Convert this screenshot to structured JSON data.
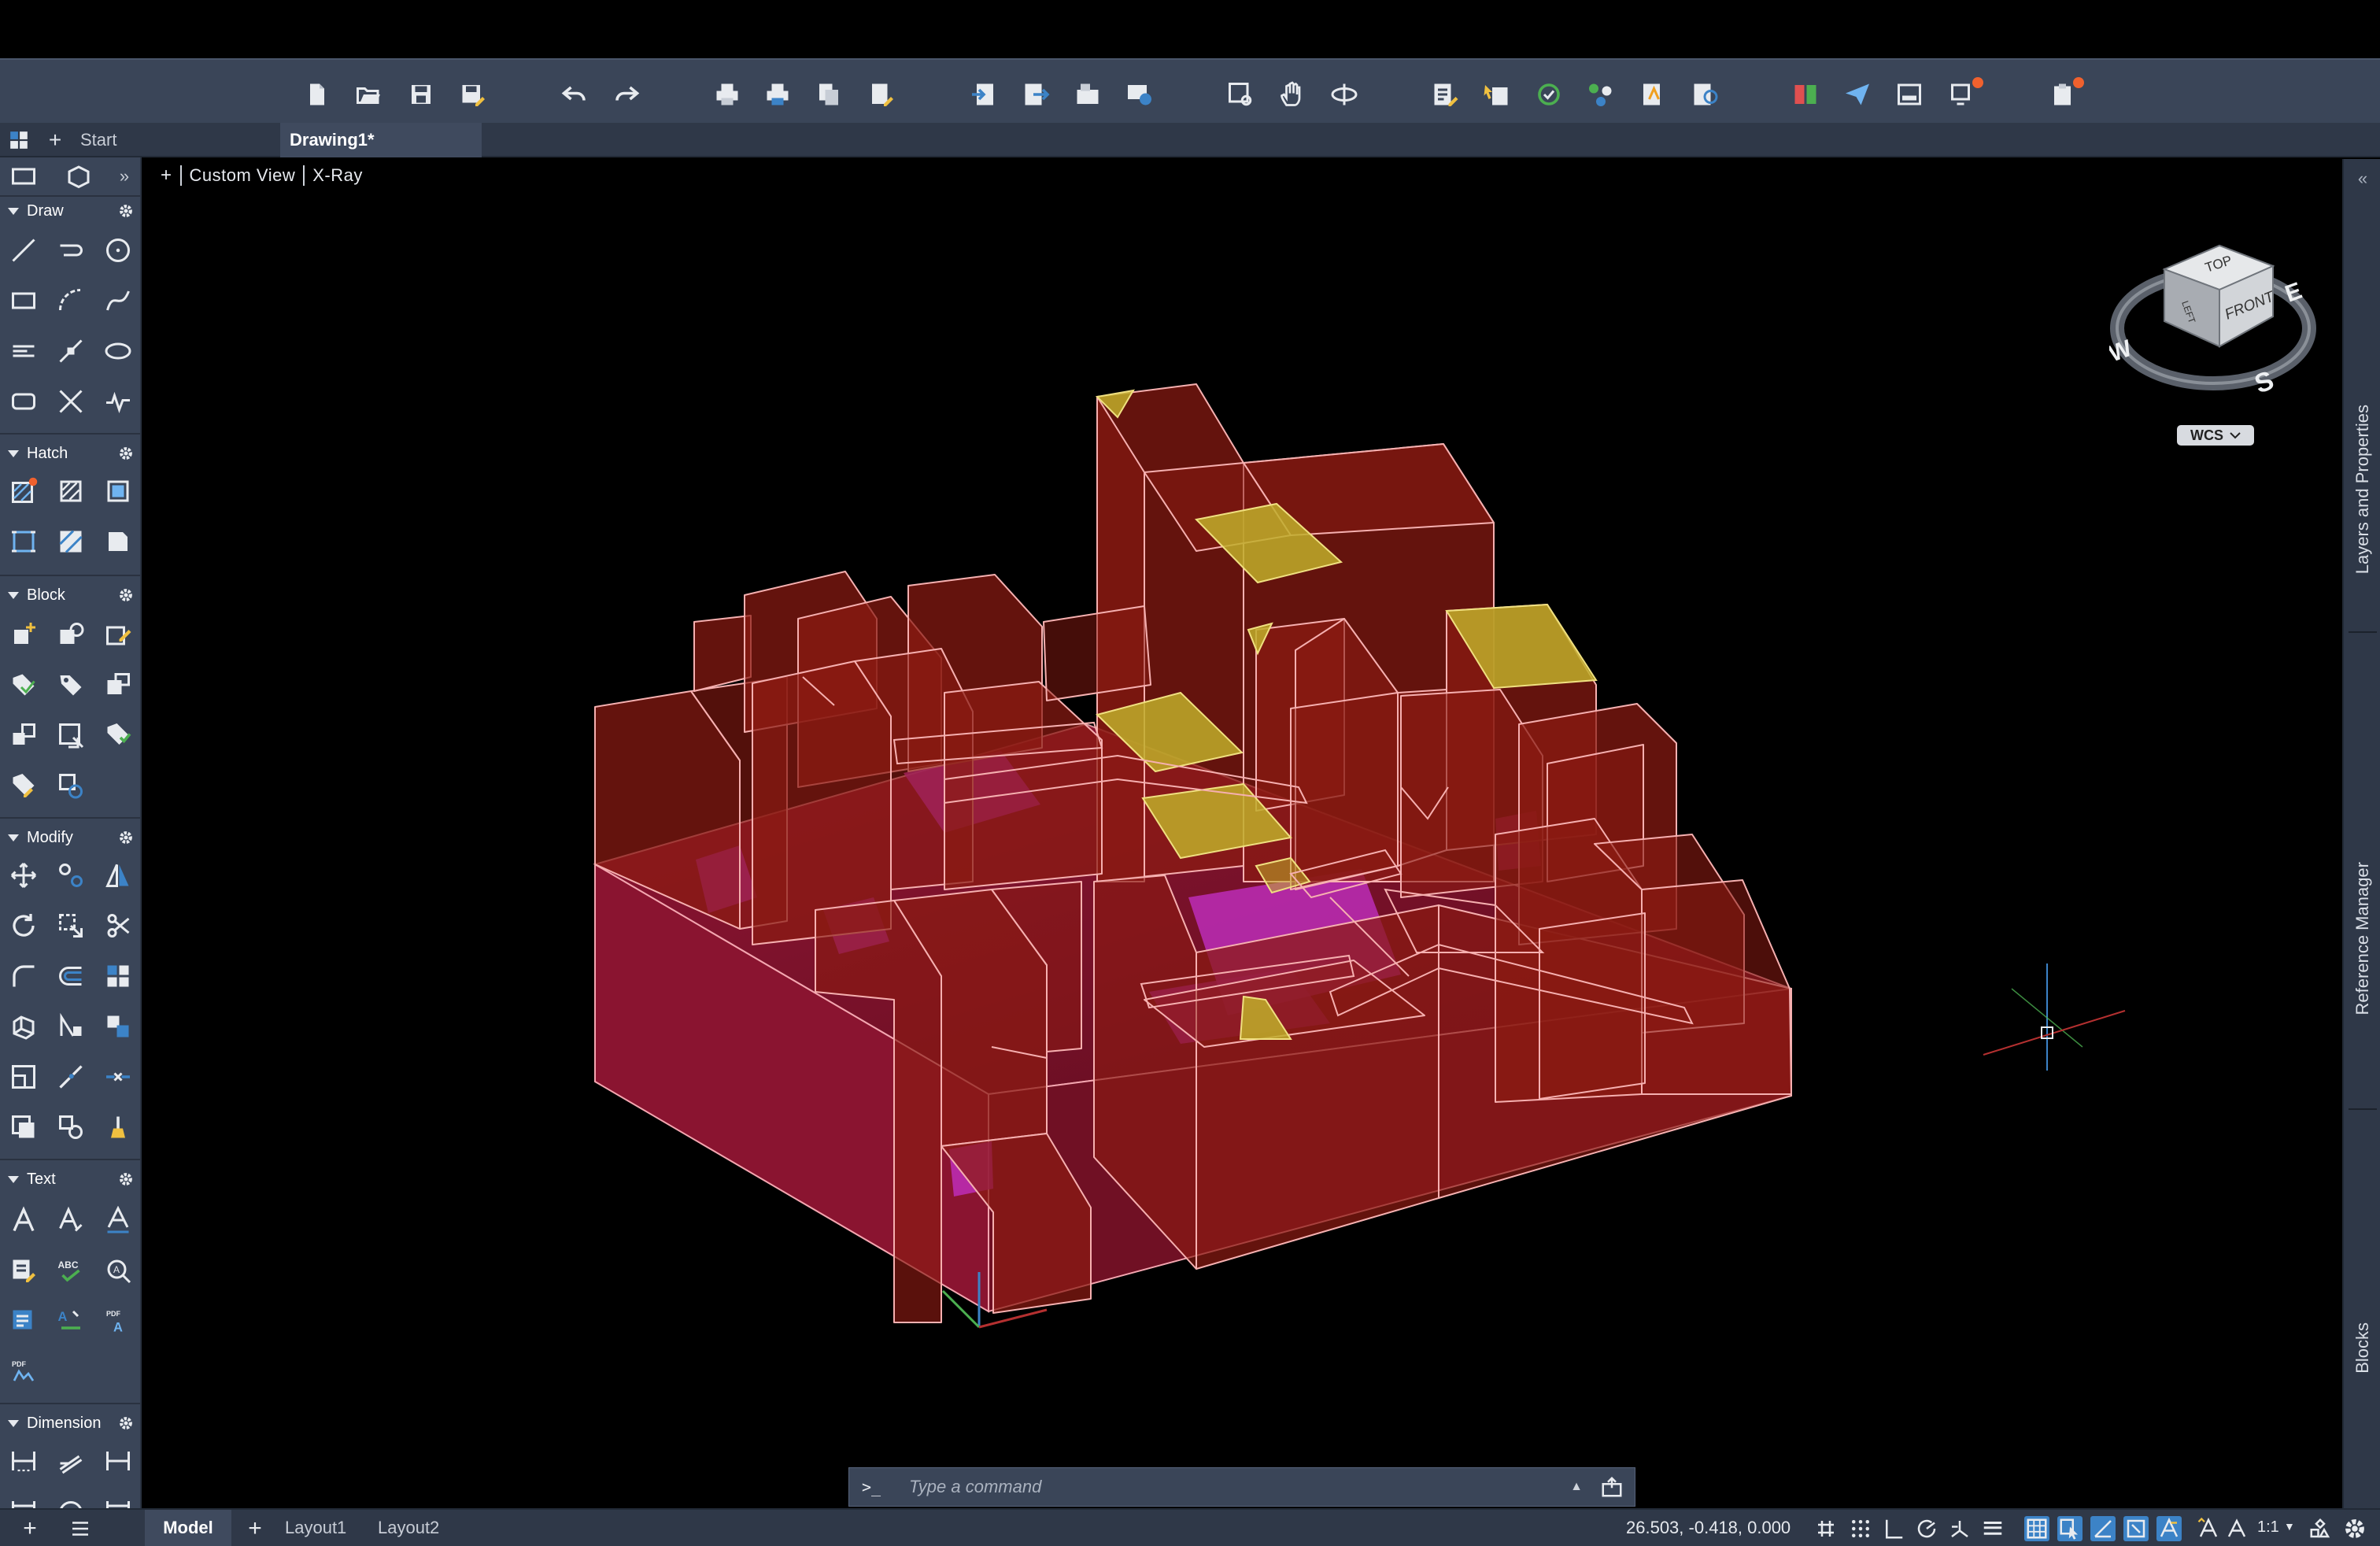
{
  "tabs": {
    "start": "Start",
    "drawing": "Drawing1*"
  },
  "view": {
    "plus": "+",
    "name": "Custom View",
    "style": "X-Ray"
  },
  "palette": {
    "sections": [
      "Draw",
      "Hatch",
      "Block",
      "Modify",
      "Text",
      "Dimension"
    ]
  },
  "right_panel": {
    "items": [
      "Layers and Properties",
      "Reference Manager",
      "Blocks"
    ]
  },
  "viewcube": {
    "top": "TOP",
    "front": "FRONT",
    "left": "LEFT",
    "east": "E",
    "west": "W",
    "south": "S",
    "wcs": "WCS"
  },
  "command": {
    "prompt": ">_",
    "placeholder": "Type a command"
  },
  "status": {
    "model": "Model",
    "layout1": "Layout1",
    "layout2": "Layout2",
    "coords": "26.503, -0.418, 0.000",
    "scale": "1:1"
  },
  "colors": {
    "toolbar_bg": "#3a4558",
    "tab_bg": "#2f3848",
    "solid_fill": "#7a1412",
    "solid_edge": "#f0a0a8",
    "yellow_face": "#b8a428",
    "magenta_face": "#c02ec0",
    "accent_blue": "#3c83c7",
    "notification": "#f0612e"
  }
}
